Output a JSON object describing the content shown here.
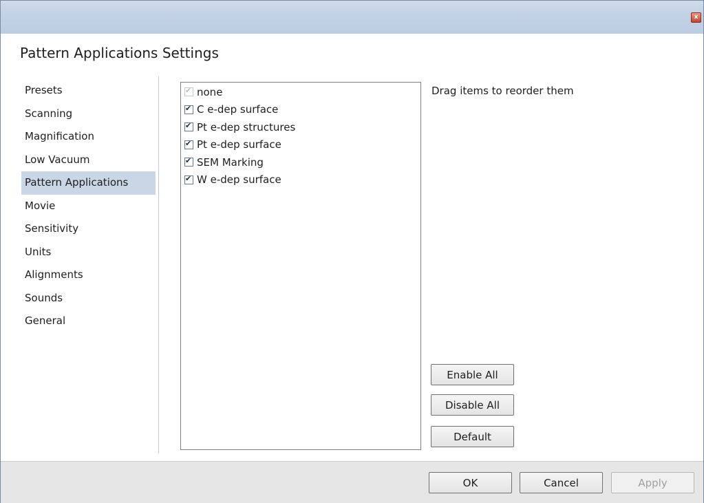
{
  "window": {
    "close_glyph": "x"
  },
  "dialog": {
    "title": "Pattern Applications Settings"
  },
  "nav": {
    "items": [
      {
        "label": "Presets"
      },
      {
        "label": "Scanning"
      },
      {
        "label": "Magnification"
      },
      {
        "label": "Low Vacuum"
      },
      {
        "label": "Pattern Applications",
        "selected": true
      },
      {
        "label": "Movie"
      },
      {
        "label": "Sensitivity"
      },
      {
        "label": "Units"
      },
      {
        "label": "Alignments"
      },
      {
        "label": "Sounds"
      },
      {
        "label": "General"
      }
    ]
  },
  "list": {
    "items": [
      {
        "label": "none",
        "checked": true,
        "disabled": true
      },
      {
        "label": "C e-dep surface",
        "checked": true
      },
      {
        "label": "Pt e-dep structures",
        "checked": true
      },
      {
        "label": "Pt e-dep surface",
        "checked": true
      },
      {
        "label": "SEM Marking",
        "checked": true
      },
      {
        "label": "W e-dep surface",
        "checked": true
      }
    ],
    "hint": "Drag items to reorder them"
  },
  "actions": {
    "enable_all": "Enable All",
    "disable_all": "Disable All",
    "default": "Default"
  },
  "footer": {
    "ok": "OK",
    "cancel": "Cancel",
    "apply": "Apply",
    "apply_disabled": true
  },
  "colors": {
    "titlebar": "#c3d2e5",
    "nav_selected": "#c8d6e6",
    "footer_bg": "#e6e6e6",
    "close_button": "#c6452d"
  }
}
